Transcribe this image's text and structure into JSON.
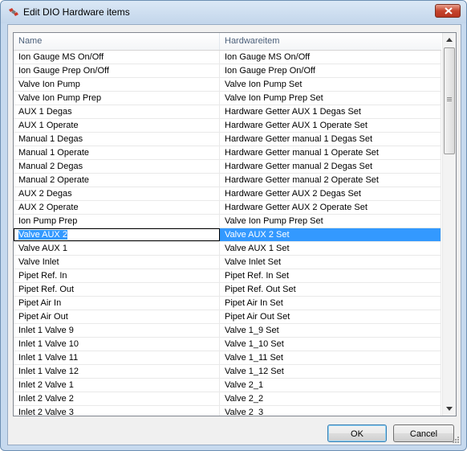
{
  "window": {
    "title": "Edit DIO Hardware items",
    "icon": "satellite-app-icon",
    "close_icon": "close-icon"
  },
  "grid": {
    "columns": [
      "Name",
      "Hardwareitem"
    ],
    "selected_row": 13,
    "rows": [
      {
        "name": "Ion Gauge MS On/Off",
        "item": "Ion Gauge MS On/Off"
      },
      {
        "name": "Ion Gauge Prep On/Off",
        "item": "Ion Gauge Prep On/Off"
      },
      {
        "name": "Valve Ion Pump",
        "item": "Valve Ion Pump Set"
      },
      {
        "name": "Valve Ion Pump Prep",
        "item": "Valve Ion Pump Prep Set"
      },
      {
        "name": "AUX 1 Degas",
        "item": "Hardware Getter AUX 1 Degas Set"
      },
      {
        "name": "AUX 1 Operate",
        "item": "Hardware Getter AUX 1 Operate Set"
      },
      {
        "name": "Manual 1 Degas",
        "item": "Hardware Getter manual 1 Degas Set"
      },
      {
        "name": "Manual 1 Operate",
        "item": "Hardware Getter manual 1 Operate Set"
      },
      {
        "name": "Manual 2 Degas",
        "item": "Hardware Getter manual 2 Degas Set"
      },
      {
        "name": "Manual 2 Operate",
        "item": "Hardware Getter manual 2 Operate Set"
      },
      {
        "name": "AUX 2 Degas",
        "item": "Hardware Getter AUX 2 Degas Set"
      },
      {
        "name": "AUX 2 Operate",
        "item": "Hardware Getter AUX 2 Operate Set"
      },
      {
        "name": "Ion Pump Prep",
        "item": "Valve Ion Pump Prep Set"
      },
      {
        "name": "Valve AUX 2",
        "item": "Valve AUX 2 Set"
      },
      {
        "name": "Valve AUX 1",
        "item": "Valve AUX 1 Set"
      },
      {
        "name": "Valve Inlet",
        "item": "Valve Inlet Set"
      },
      {
        "name": "Pipet Ref. In",
        "item": "Pipet Ref. In Set"
      },
      {
        "name": "Pipet Ref. Out",
        "item": "Pipet Ref. Out Set"
      },
      {
        "name": "Pipet Air In",
        "item": "Pipet Air In Set"
      },
      {
        "name": "Pipet Air Out",
        "item": "Pipet Air Out Set"
      },
      {
        "name": "Inlet 1 Valve 9",
        "item": "Valve 1_9 Set"
      },
      {
        "name": "Inlet 1 Valve 10",
        "item": "Valve 1_10 Set"
      },
      {
        "name": "Inlet 1 Valve 11",
        "item": "Valve 1_11 Set"
      },
      {
        "name": "Inlet 1 Valve 12",
        "item": "Valve 1_12 Set"
      },
      {
        "name": "Inlet 2 Valve 1",
        "item": "Valve 2_1"
      },
      {
        "name": "Inlet 2 Valve 2",
        "item": "Valve 2_2"
      },
      {
        "name": "Inlet 2 Valve 3",
        "item": "Valve 2_3"
      }
    ]
  },
  "scrollbar": {
    "up_icon": "scroll-up-arrow-icon",
    "down_icon": "scroll-down-arrow-icon",
    "position": 0.0
  },
  "buttons": {
    "ok_label": "OK",
    "cancel_label": "Cancel"
  },
  "colors": {
    "selection": "#3399ff",
    "close_button": "#c5452d"
  }
}
